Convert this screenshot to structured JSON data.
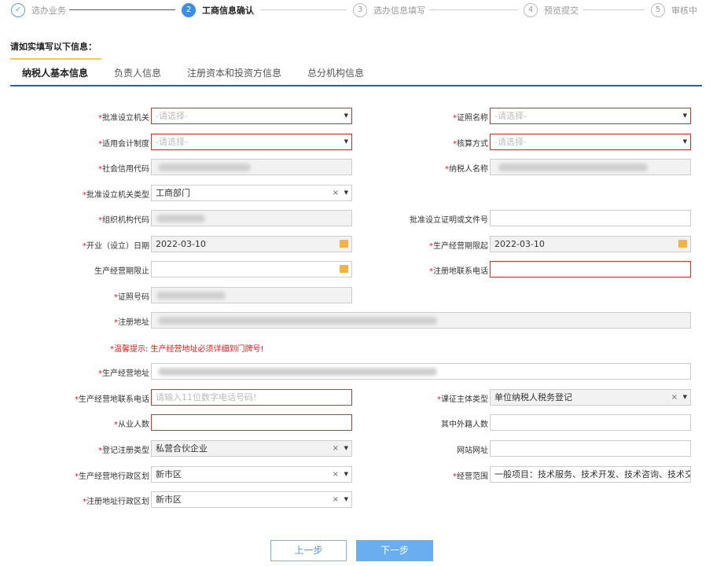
{
  "steps": [
    {
      "num": "✓",
      "label": "选办业务"
    },
    {
      "num": "2",
      "label": "工商信息确认"
    },
    {
      "num": "3",
      "label": "选办信息填写"
    },
    {
      "num": "4",
      "label": "预览提交"
    },
    {
      "num": "5",
      "label": "审核中"
    }
  ],
  "instruction": "请如实填写以下信息：",
  "tabs": [
    "纳税人基本信息",
    "负责人信息",
    "注册资本和投资方信息",
    "总分机构信息"
  ],
  "required_mark": "*",
  "fields": {
    "pzslj": {
      "label": "批准设立机关",
      "placeholder": "-请选择-"
    },
    "zzmc": {
      "label": "证照名称",
      "placeholder": "-请选择-"
    },
    "syhjzd": {
      "label": "适用会计制度",
      "placeholder": "-请选择-"
    },
    "hsfs": {
      "label": "核算方式",
      "placeholder": "-请选择-"
    },
    "shxydm": {
      "label": "社会信用代码"
    },
    "nsrmc": {
      "label": "纳税人名称"
    },
    "pzsljglx": {
      "label": "批准设立机关类型",
      "value": "工商部门"
    },
    "zzjgdm": {
      "label": "组织机构代码"
    },
    "pzslzmwjh": {
      "label": "批准设立证明或文件号"
    },
    "kysl": {
      "label": "开业（设立）日期",
      "value": "2022-03-10"
    },
    "scjyqxq": {
      "label": "生产经营期限起",
      "value": "2022-03-10"
    },
    "scjyqxz": {
      "label": "生产经营期限止"
    },
    "zcdlxdh": {
      "label": "注册地联系电话"
    },
    "zzhm": {
      "label": "证照号码"
    },
    "zcdz": {
      "label": "注册地址"
    },
    "warning": "*温馨提示: 生产经营地址必须详细到门牌号!",
    "scjydz": {
      "label": "生产经营地址"
    },
    "scjydlxdh": {
      "label": "生产经营地联系电话",
      "placeholder": "请输入11位数字电话号码!"
    },
    "kzztlx": {
      "label": "课征主体类型",
      "value": "单位纳税人税务登记"
    },
    "cyrs": {
      "label": "从业人数"
    },
    "wjrs": {
      "label": "其中外籍人数"
    },
    "djzclx": {
      "label": "登记注册类型",
      "value": "私营合伙企业"
    },
    "wzwz": {
      "label": "网站网址"
    },
    "scjydxzqh": {
      "label": "生产经营地行政区划",
      "value": "新市区"
    },
    "jyfw": {
      "label": "经营范围",
      "value": "一般项目：技术服务、技术开发、技术咨询、技术交流"
    },
    "zcdzxzqh": {
      "label": "注册地址行政区划",
      "value": "新市区"
    }
  },
  "buttons": {
    "prev": "上一步",
    "next": "下一步"
  },
  "icons": {
    "clear": "×",
    "dropdown": "▼",
    "calendar": "calendar-icon"
  },
  "colors": {
    "accent": "#3a8ee6",
    "error": "#d43030",
    "next_button": "#6aaef0"
  }
}
